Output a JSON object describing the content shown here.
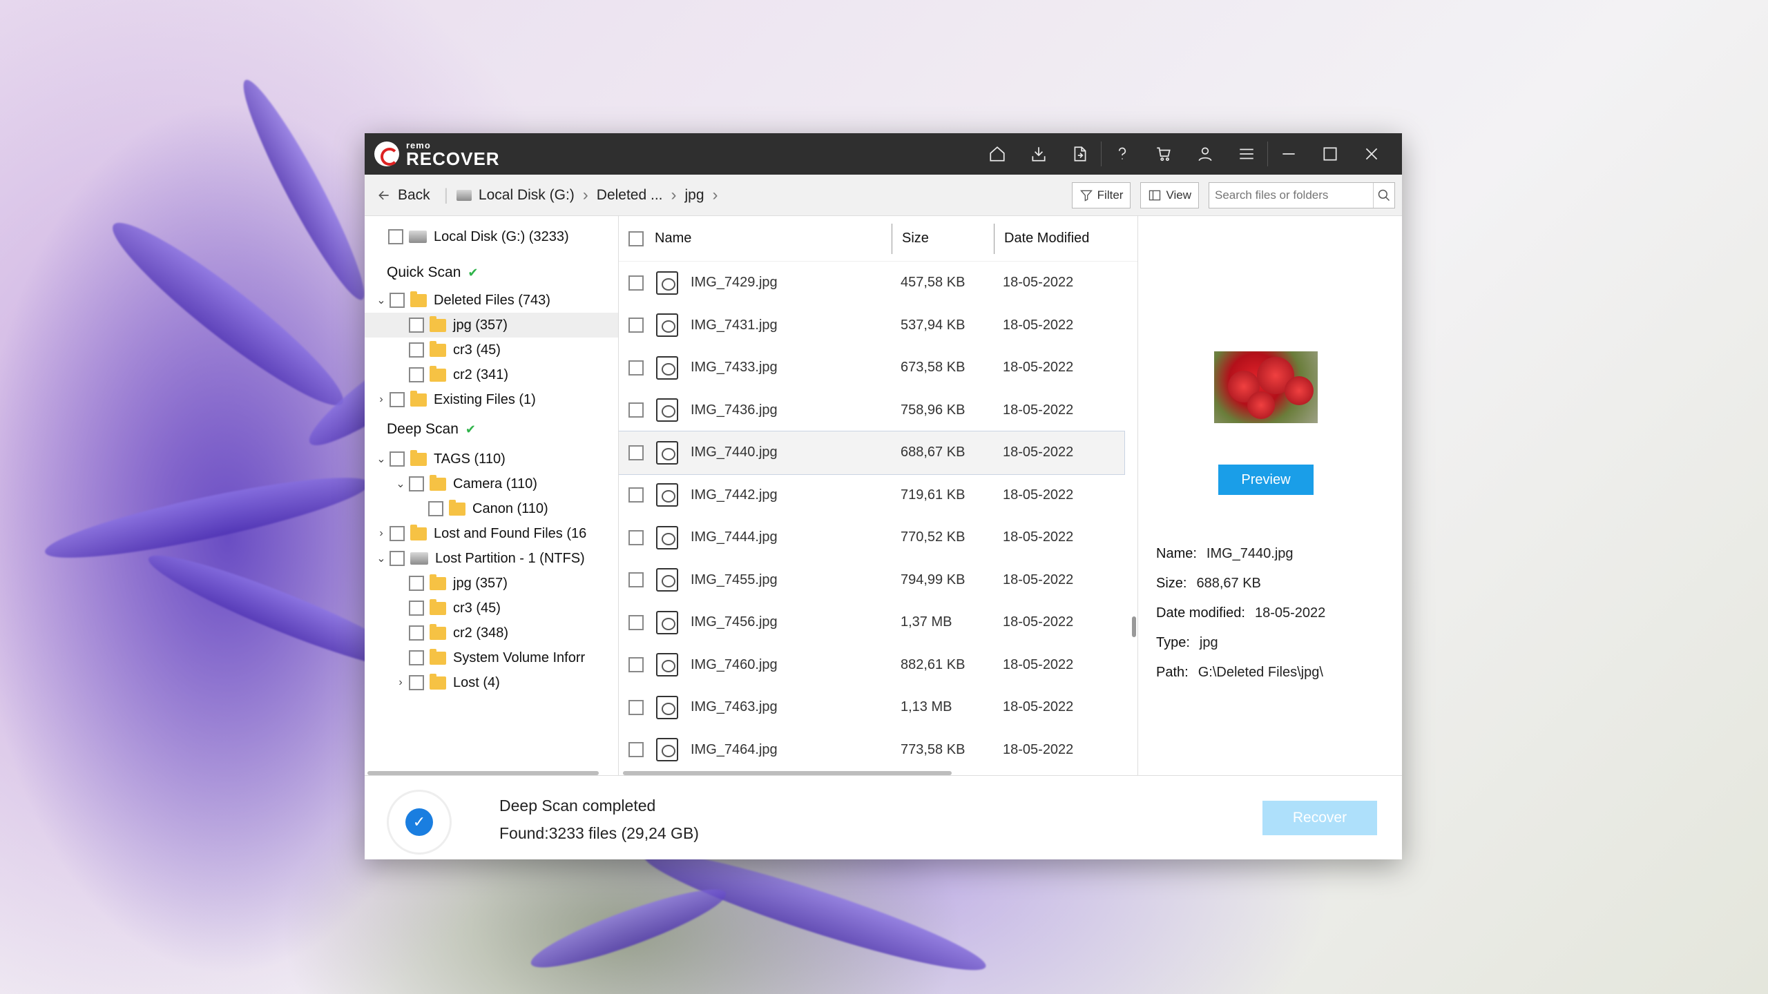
{
  "app": {
    "logo_small": "remo",
    "logo_big": "RECOVER"
  },
  "titlebar_icons": [
    "home-icon",
    "download-icon",
    "export-icon",
    "help-icon",
    "cart-icon",
    "user-icon",
    "menu-icon",
    "minimize-icon",
    "maximize-icon",
    "close-icon"
  ],
  "nav": {
    "back": "Back",
    "crumbs": [
      "Local Disk (G:)",
      "Deleted ...",
      "jpg"
    ],
    "filter": "Filter",
    "view": "View",
    "search_placeholder": "Search files or folders"
  },
  "tree": {
    "root": "Local Disk (G:) (3233)",
    "quick_scan": "Quick Scan",
    "deep_scan": "Deep Scan",
    "quick": [
      {
        "label": "Deleted Files (743)",
        "level": 1,
        "exp": "v"
      },
      {
        "label": "jpg (357)",
        "level": 2,
        "exp": "",
        "hl": true
      },
      {
        "label": "cr3 (45)",
        "level": 2,
        "exp": ""
      },
      {
        "label": "cr2 (341)",
        "level": 2,
        "exp": ""
      },
      {
        "label": "Existing Files (1)",
        "level": 1,
        "exp": ">"
      }
    ],
    "deep": [
      {
        "label": "TAGS (110)",
        "level": 1,
        "exp": "v"
      },
      {
        "label": "Camera (110)",
        "level": 2,
        "exp": "v"
      },
      {
        "label": "Canon (110)",
        "level": 3,
        "exp": ""
      },
      {
        "label": "Lost and Found Files (16",
        "level": 1,
        "exp": ">"
      },
      {
        "label": "Lost Partition - 1 (NTFS)",
        "level": 1,
        "exp": "v",
        "drive": true
      },
      {
        "label": "jpg (357)",
        "level": 2,
        "exp": ""
      },
      {
        "label": "cr3 (45)",
        "level": 2,
        "exp": ""
      },
      {
        "label": "cr2 (348)",
        "level": 2,
        "exp": ""
      },
      {
        "label": "System Volume Inforr",
        "level": 2,
        "exp": ""
      },
      {
        "label": "Lost (4)",
        "level": 2,
        "exp": ">"
      }
    ]
  },
  "list": {
    "headers": {
      "name": "Name",
      "size": "Size",
      "date": "Date Modified"
    },
    "rows": [
      {
        "name": "IMG_7429.jpg",
        "size": "457,58 KB",
        "date": "18-05-2022"
      },
      {
        "name": "IMG_7431.jpg",
        "size": "537,94 KB",
        "date": "18-05-2022"
      },
      {
        "name": "IMG_7433.jpg",
        "size": "673,58 KB",
        "date": "18-05-2022"
      },
      {
        "name": "IMG_7436.jpg",
        "size": "758,96 KB",
        "date": "18-05-2022"
      },
      {
        "name": "IMG_7440.jpg",
        "size": "688,67 KB",
        "date": "18-05-2022",
        "selected": true
      },
      {
        "name": "IMG_7442.jpg",
        "size": "719,61 KB",
        "date": "18-05-2022"
      },
      {
        "name": "IMG_7444.jpg",
        "size": "770,52 KB",
        "date": "18-05-2022"
      },
      {
        "name": "IMG_7455.jpg",
        "size": "794,99 KB",
        "date": "18-05-2022"
      },
      {
        "name": "IMG_7456.jpg",
        "size": "1,37 MB",
        "date": "18-05-2022"
      },
      {
        "name": "IMG_7460.jpg",
        "size": "882,61 KB",
        "date": "18-05-2022"
      },
      {
        "name": "IMG_7463.jpg",
        "size": "1,13 MB",
        "date": "18-05-2022"
      },
      {
        "name": "IMG_7464.jpg",
        "size": "773,58 KB",
        "date": "18-05-2022"
      }
    ]
  },
  "preview": {
    "button": "Preview",
    "name_label": "Name:",
    "name": "IMG_7440.jpg",
    "size_label": "Size:",
    "size": "688,67 KB",
    "date_label": "Date modified:",
    "date": "18-05-2022",
    "type_label": "Type:",
    "type": "jpg",
    "path_label": "Path:",
    "path": "G:\\Deleted Files\\jpg\\"
  },
  "footer": {
    "status": "Deep Scan completed",
    "found": "Found:3233 files (29,24 GB)",
    "recover": "Recover"
  },
  "colors": {
    "titlebar": "#2f2f2f",
    "accent": "#1a9ee8",
    "recover_disabled": "#aee0fb",
    "check": "#2fb34a"
  }
}
